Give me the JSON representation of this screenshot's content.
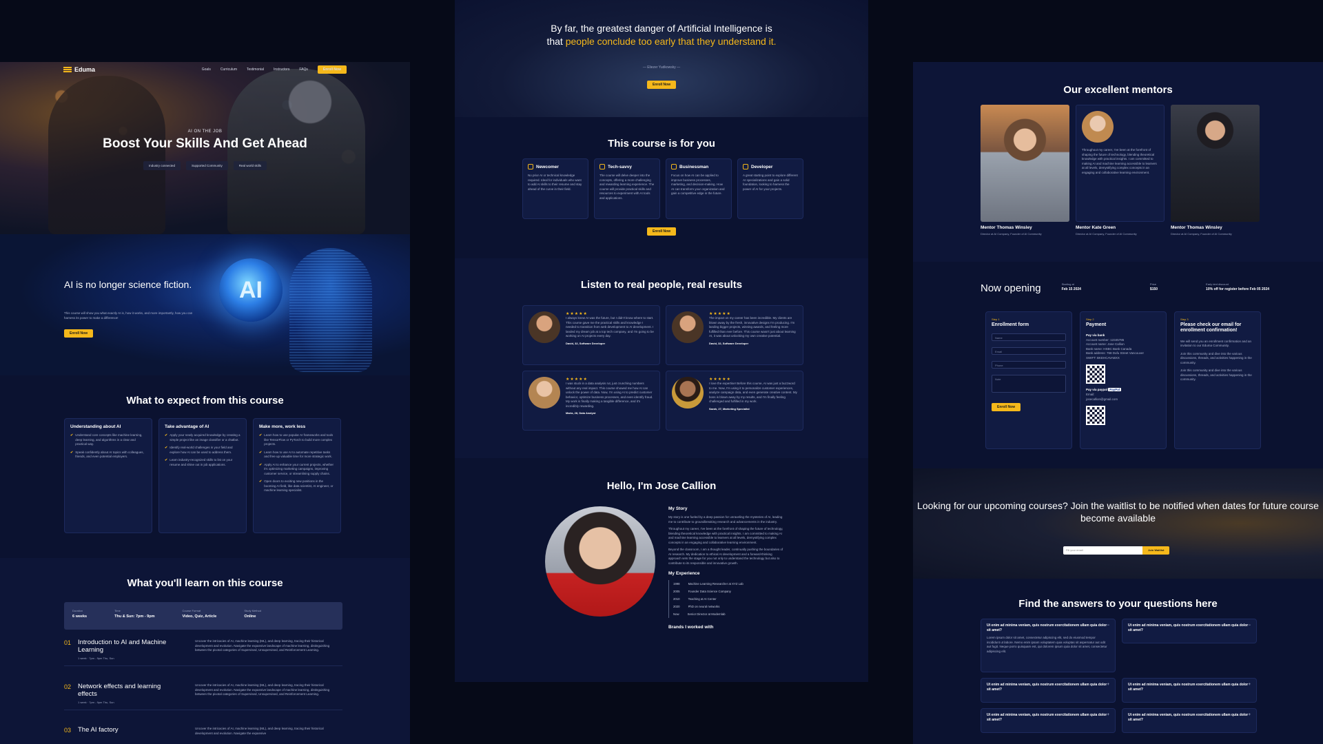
{
  "heroA": {
    "logo": "Eduma",
    "nav": [
      "Goals",
      "Curriculum",
      "Testimonial",
      "Instructors",
      "FAQs"
    ],
    "nav_cta": "Enroll Now",
    "eyebrow": "AI ON THE JOB",
    "title": "Boost Your Skills And Get Ahead",
    "chips": [
      "Industry connected",
      "Supported Community",
      "Real world skills"
    ]
  },
  "ai": {
    "title": "AI is no longer science fiction.",
    "text": "This course will show you what exactly AI is, how it works, and more importantly, how you can harness its power to make a difference!",
    "globe": "AI",
    "button": "Enroll Now"
  },
  "expect": {
    "title": "What to expect from this course",
    "cards": [
      {
        "title": "Understanding about AI",
        "items": [
          "Understand core concepts like machine learning, deep learning, and algorithms in a clear and practical way.",
          "Speak confidently about AI topics with colleagues, friends, and even potential employers."
        ]
      },
      {
        "title": "Take advantage of AI",
        "items": [
          "Apply your newly acquired knowledge by creating a simple project like an image classifier or a chatbot.",
          "Identify real-world challenges in your field and explore how AI can be used to address them.",
          "Learn industry-recognized skills to list on your resume and shine out in job applications."
        ]
      },
      {
        "title": "Make more, work less",
        "items": [
          "Learn how to use popular AI frameworks and tools like TensorFlow or PyTorch to build more complex projects.",
          "Learn how to use AI to automate repetitive tasks and free up valuable time for more strategic work.",
          "Apply AI to enhance your current projects, whether it's optimizing marketing campaigns, improving customer service, or streamlining supply chains.",
          "Open doors to exciting new positions in the booming AI field, like data scientist, AI engineer, or machine learning specialist."
        ]
      }
    ]
  },
  "learn": {
    "title": "What you'll learn on this course",
    "meta": [
      {
        "label": "Duration",
        "value": "6 weeks"
      },
      {
        "label": "Time",
        "value": "Thu & Sun: 7pm - 9pm"
      },
      {
        "label": "Course Format",
        "value": "Video, Quiz, Article"
      },
      {
        "label": "Study Method",
        "value": "Online"
      }
    ],
    "lessons": [
      {
        "num": "01",
        "title": "Introduction to AI and Machine Learning",
        "meta": "1 week · 7pm - 9pm Thu, Sun",
        "desc": "Uncover the intricacies of AI, machine learning (ML), and deep learning, tracing their historical development and evolution. Navigate the expansive landscape of machine learning, distinguishing between the pivotal categories of Supervised, Unsupervised, and Reinforcement Learning."
      },
      {
        "num": "02",
        "title": "Network effects and learning effects",
        "meta": "1 week · 7pm - 9pm Thu, Sun",
        "desc": "Uncover the intricacies of AI, machine learning (ML), and deep learning, tracing their historical development and evolution. Navigate the expansive landscape of machine learning, distinguishing between the pivotal categories of Supervised, Unsupervised, and Reinforcement Learning."
      },
      {
        "num": "03",
        "title": "The AI factory",
        "meta": "",
        "desc": "Uncover the intricacies of AI, machine learning (ML), and deep learning, tracing their historical development and evolution. Navigate the expansive"
      }
    ]
  },
  "quote": {
    "text1": "By far, the greatest danger of Artificial Intelligence is that ",
    "highlight": "people conclude too early that they understand it.",
    "author": "— Eliezer Yudkowsky —",
    "button": "Enroll Now"
  },
  "forWho": {
    "title": "This course is for you",
    "cards": [
      {
        "title": "Newcomer",
        "text": "No prior AI or technical knowledge required. Ideal for individuals who want to add AI skills to their resume and stay ahead of the curve in their field."
      },
      {
        "title": "Tech-savvy",
        "text": "The course will delve deeper into the concepts, offering a more challenging and rewarding learning experience. The course will provide practical skills and resources to experiment with AI tools and applications."
      },
      {
        "title": "Businessman",
        "text": "Focus on how AI can be applied to improve business processes, marketing, and decision-making. How AI can transform your organization and gain a competitive edge in the future."
      },
      {
        "title": "Developer",
        "text": "A great starting point to explore different AI specializations and gain a solid foundation, looking to harness the power of AI for your projects."
      }
    ],
    "button": "Enroll Now"
  },
  "real": {
    "title": "Listen to real people, real results",
    "testimonials": [
      {
        "stars": "★★★★★",
        "text": "I always knew AI was the future, but I didn't know where to start. This course gave me the practical skills and knowledge I needed to transition from web development to AI development. I landed my dream job at a top tech company, and I'm going to be working on AI projects every day.",
        "name": "David, 32, Software Developer"
      },
      {
        "stars": "★★★★★",
        "text": "The impact on my career has been incredible. My clients are blown away by the fresh, innovative designs I'm producing. I'm landing bigger projects, winning awards, and feeling more fulfilled than ever before. This course wasn't just about learning AI, it was about unlocking my own creative potential.",
        "name": "David, 32, Software Developer"
      },
      {
        "stars": "★★★★★",
        "text": "I was stuck in a data analysis rut, just crunching numbers without any real impact. This course showed me how AI can unlock the power of data. Now, I'm using AI to predict customer behavior, optimize business processes, and even identify fraud. My work is finally making a tangible difference, and it's incredibly rewarding.",
        "name": "Maria, 28, Data Analyst"
      },
      {
        "stars": "★★★★★",
        "text": "I love the expertise! Before this course, AI was just a buzzword to me. Now, I'm using it to personalize customer experiences, analyze campaign data, and even generate creative content. My boss is blown away by my results, and I'm finally feeling challenged and fulfilled in my work.",
        "name": "Sarah, 27, Marketing Specialist"
      }
    ]
  },
  "hello": {
    "title": "Hello, I'm Jose Callion",
    "story_title": "My Story",
    "story": [
      "My story is one fueled by a deep passion for unraveling the mysteries of AI, leading me to contribute to groundbreaking research and advancements in the industry.",
      "Throughout my career, I've been at the forefront of shaping the future of technology, blending theoretical knowledge with practical insights. I am committed to making AI and machine learning accessible to learners at all levels, demystifying complex concepts in an engaging and collaborative learning environment.",
      "Beyond the classroom, I am a thought leader, continually pushing the boundaries of AI research. My dedication to ethical AI development and a forward-thinking approach sets the stage for you not only to understand the technology but also to contribute to its responsible and innovative growth."
    ],
    "exp_title": "My Experience",
    "experience": [
      {
        "year": "1998",
        "role": "Machine Learning Researcher at XYZ Lab"
      },
      {
        "year": "2005",
        "role": "Founder Data Science Company"
      },
      {
        "year": "2010",
        "role": "Teaching at AI Center"
      },
      {
        "year": "2020",
        "role": "PhD on neural networks"
      },
      {
        "year": "Now",
        "role": "Senior Director at Modernlab"
      }
    ],
    "brands_title": "Brands I worked with"
  },
  "mentors": {
    "title": "Our excellent mentors",
    "list": [
      {
        "name": "Mentor Thomas Winsley",
        "role": "Director at AI Company, Founder of AI Community"
      },
      {
        "name": "Mentor Kate Green",
        "role": "Director at AI Company, Founder of AI Community",
        "bio": "Throughout my career, I've been at the forefront of shaping the future of technology, blending theoretical knowledge with practical insights. I am committed to making AI and machine learning accessible to learners at all levels, demystifying complex concepts in an engaging and collaborative learning environment."
      },
      {
        "name": "Mentor Thomas Winsley",
        "role": "Director at AI Company, Founder of AI Community"
      }
    ]
  },
  "opening": {
    "title": "Now opening",
    "meta": [
      {
        "label": "Starting at",
        "value": "Feb 15 2024"
      },
      {
        "label": "Price",
        "value": "$150"
      },
      {
        "label": "Early bird discount",
        "value": "10% off for register before Feb 05 2024"
      }
    ],
    "steps": [
      {
        "step": "Step 1",
        "title": "Enrollment form",
        "fields": [
          "Name",
          "Email",
          "Phone",
          "Note"
        ],
        "button": "Enroll Now"
      },
      {
        "step": "Step 2",
        "title": "Payment",
        "bank_title": "Pay via bank",
        "bank": [
          "Account number: 12345785",
          "Account name: Jose Callion",
          "Bank name: HSBC Bank Canada",
          "Bank address: 768 Dufu Street Vancouver",
          "SWIFT: BKEHCAVABXX"
        ],
        "paypal_title": "Pay via paypal",
        "paypal_badge": "PayPal",
        "paypal": [
          "Email:",
          "josecallion@gmail.com"
        ]
      },
      {
        "step": "Step 3",
        "title": "Please check our email for enrollment confirmation!",
        "paras": [
          "We will send you an enrollment confirmation and an invitation to our Eduma Community.",
          "Join this community and dive into the various discussions, threads, and activities happening in the community.",
          "Join this community and dive into the various discussions, threads, and activities happening in the community."
        ]
      }
    ]
  },
  "waitlist": {
    "text": "Looking for our upcoming courses? Join the waitlist to be notified when dates for future course become available",
    "placeholder": "Fill your email",
    "button": "Join Waitlist"
  },
  "faq": {
    "title": "Find the answers to your questions here",
    "question": "Ut enim ad minima veniam, quis nostrum exercitationem ullam quia dolor sit amet?",
    "answer": "Lorem ipsum dolor sit amet, consectetur adipiscing elit, sed do eiusmod tempor incididunt ut labore. Nemo enim ipsam voluptatem quia voluptas sit aspernatur aut odit aut fugit. Neque porro quisquam est, qui dolorem ipsum quia dolor sit amet, consectetur adipiscing elit.",
    "open_icon": "−",
    "closed_icon": "+"
  }
}
